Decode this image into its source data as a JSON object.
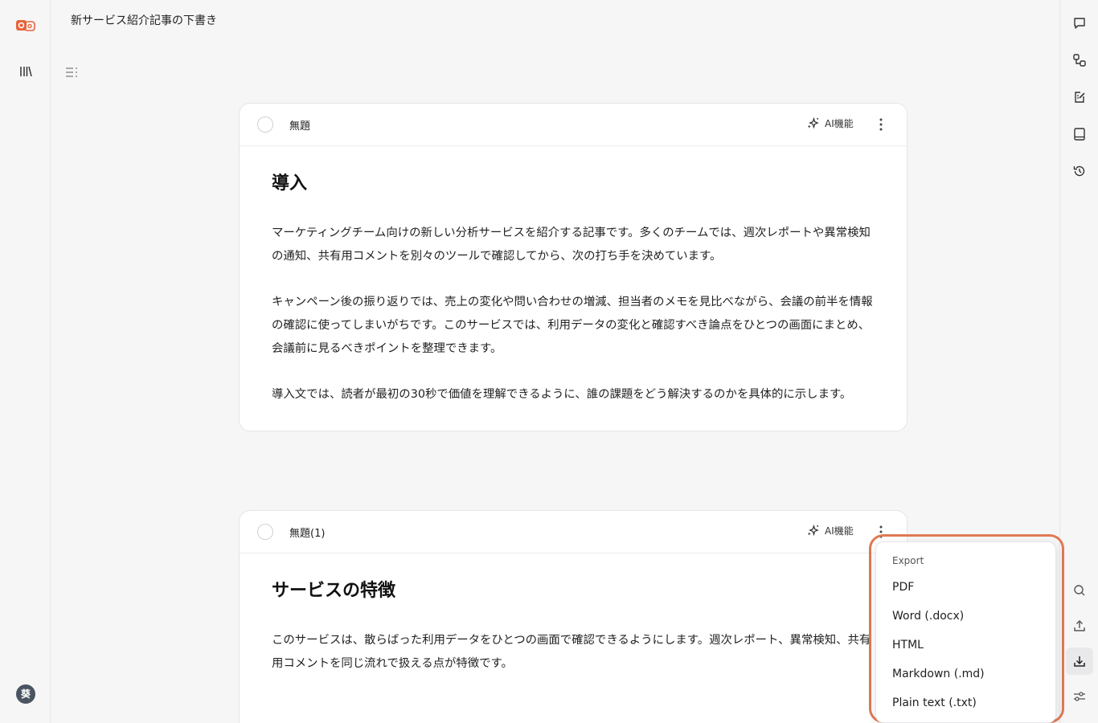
{
  "document": {
    "title": "新サービス紹介記事の下書き"
  },
  "sidebar": {
    "avatar_letter": "葵"
  },
  "cards": [
    {
      "name": "無題",
      "ai_label": "AI機能",
      "heading": "導入",
      "paragraphs": [
        "マーケティングチーム向けの新しい分析サービスを紹介する記事です。多くのチームでは、週次レポートや異常検知の通知、共有用コメントを別々のツールで確認してから、次の打ち手を決めています。",
        "キャンペーン後の振り返りでは、売上の変化や問い合わせの増減、担当者のメモを見比べながら、会議の前半を情報の確認に使ってしまいがちです。このサービスでは、利用データの変化と確認すべき論点をひとつの画面にまとめ、会議前に見るべきポイントを整理できます。",
        "導入文では、読者が最初の30秒で価値を理解できるように、誰の課題をどう解決するのかを具体的に示します。"
      ]
    },
    {
      "name": "無題(1)",
      "ai_label": "AI機能",
      "heading": "サービスの特徴",
      "paragraphs": [
        "このサービスは、散らばった利用データをひとつの画面で確認できるようにします。週次レポート、異常検知、共有用コメントを同じ流れで扱える点が特徴です。"
      ]
    }
  ],
  "export_menu": {
    "title": "Export",
    "items": [
      "PDF",
      "Word (.docx)",
      "HTML",
      "Markdown (.md)",
      "Plain text (.txt)"
    ]
  },
  "colors": {
    "accent": "#e07a55",
    "brand": "#e8643c"
  }
}
